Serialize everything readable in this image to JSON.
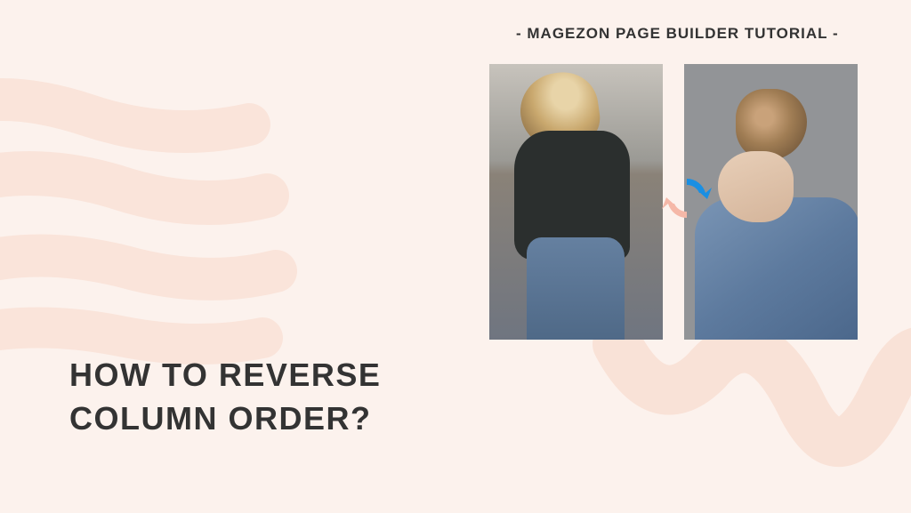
{
  "subtitle": "- MAGEZON PAGE BUILDER TUTORIAL -",
  "title_line1": "HOW TO REVERSE",
  "title_line2": "COLUMN ORDER?",
  "colors": {
    "brush": "#f9dccf",
    "arrow_blue": "#1a8fe3",
    "arrow_pink": "#f5b8a8",
    "text": "#333333",
    "background": "#fcf2ed"
  }
}
